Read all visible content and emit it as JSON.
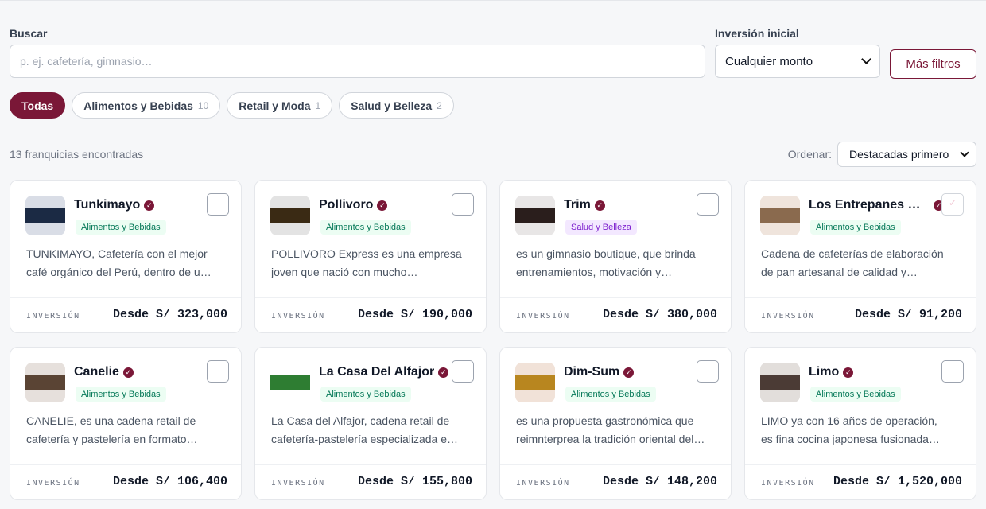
{
  "filters": {
    "search_label": "Buscar",
    "search_placeholder": "p. ej. cafetería, gimnasio…",
    "search_value": "",
    "investment_label": "Inversión inicial",
    "investment_selected": "Cualquier monto",
    "more_filters_label": "Más filtros"
  },
  "chips": [
    {
      "label": "Todas",
      "count": ""
    },
    {
      "label": "Alimentos y Bebidas",
      "count": "10"
    },
    {
      "label": "Retail y Moda",
      "count": "1"
    },
    {
      "label": "Salud y Belleza",
      "count": "2"
    }
  ],
  "results": {
    "count_text": "13 franquicias encontradas",
    "sort_label": "Ordenar:",
    "sort_selected": "Destacadas primero"
  },
  "colors": {
    "brand": "#7a1737",
    "food_tag_bg": "#ecfdf3",
    "food_tag_text": "#047857",
    "beauty_tag_bg": "#f3e8ff",
    "beauty_tag_text": "#7e22ce"
  },
  "investment_label": "INVERSIÓN",
  "cards": [
    {
      "name": "Tunkimayo",
      "category": "Alimentos y Bebidas",
      "cat_class": "food",
      "desc1": "TUNKIMAYO, Cafetería con el mejor",
      "desc2": "café orgánico del Perú, dentro de u…",
      "investment": "Desde S/ 323,000",
      "thumb_bg": "#d9dde6",
      "thumb_band": "#1b2a44"
    },
    {
      "name": "Pollivoro",
      "category": "Alimentos y Bebidas",
      "cat_class": "food",
      "desc1": "POLLIVORO Express es una empresa",
      "desc2": "joven que nació con mucho…",
      "investment": "Desde S/ 190,000",
      "thumb_bg": "#e3e3e3",
      "thumb_band": "#3a2a14"
    },
    {
      "name": "Trim",
      "category": "Salud y Belleza",
      "cat_class": "beauty",
      "desc1": "es un gimnasio boutique, que brinda",
      "desc2": "entrenamientos, motivación y…",
      "investment": "Desde S/ 380,000",
      "thumb_bg": "#e8e6e6",
      "thumb_band": "#2a1e1c"
    },
    {
      "name": "Los Entrepanes De Papá",
      "category": "Alimentos y Bebidas",
      "cat_class": "food",
      "desc1": "Cadena de cafeterías de elaboración",
      "desc2": "de pan artesanal de calidad y…",
      "investment": "Desde S/ 91,200",
      "thumb_bg": "#efe4dc",
      "thumb_band": "#8a6a4e"
    },
    {
      "name": "Canelie",
      "category": "Alimentos y Bebidas",
      "cat_class": "food",
      "desc1": "CANELIE, es una cadena retail de",
      "desc2": "cafetería y pastelería en formato…",
      "investment": "Desde S/ 106,400",
      "thumb_bg": "#e6e0dc",
      "thumb_band": "#5a4434"
    },
    {
      "name": "La Casa Del Alfajor",
      "category": "Alimentos y Bebidas",
      "cat_class": "food",
      "desc1": "La Casa del Alfajor, cadena retail de",
      "desc2": "cafetería-pastelería especializada e…",
      "investment": "Desde S/ 155,800",
      "thumb_bg": "#ffffff",
      "thumb_band": "#2e7d32"
    },
    {
      "name": "Dim-Sum",
      "category": "Alimentos y Bebidas",
      "cat_class": "food",
      "desc1": "es una propuesta gastronómica que",
      "desc2": "reimnterprea la tradición oriental del…",
      "investment": "Desde S/ 148,200",
      "thumb_bg": "#f1e2d8",
      "thumb_band": "#b8861f"
    },
    {
      "name": "Limo",
      "category": "Alimentos y Bebidas",
      "cat_class": "food",
      "desc1": "LIMO ya con 16 años de operación,",
      "desc2": "es fina cocina japonesa fusionada…",
      "investment": "Desde S/ 1,520,000",
      "thumb_bg": "#e2dedb",
      "thumb_band": "#4b3b35"
    }
  ]
}
